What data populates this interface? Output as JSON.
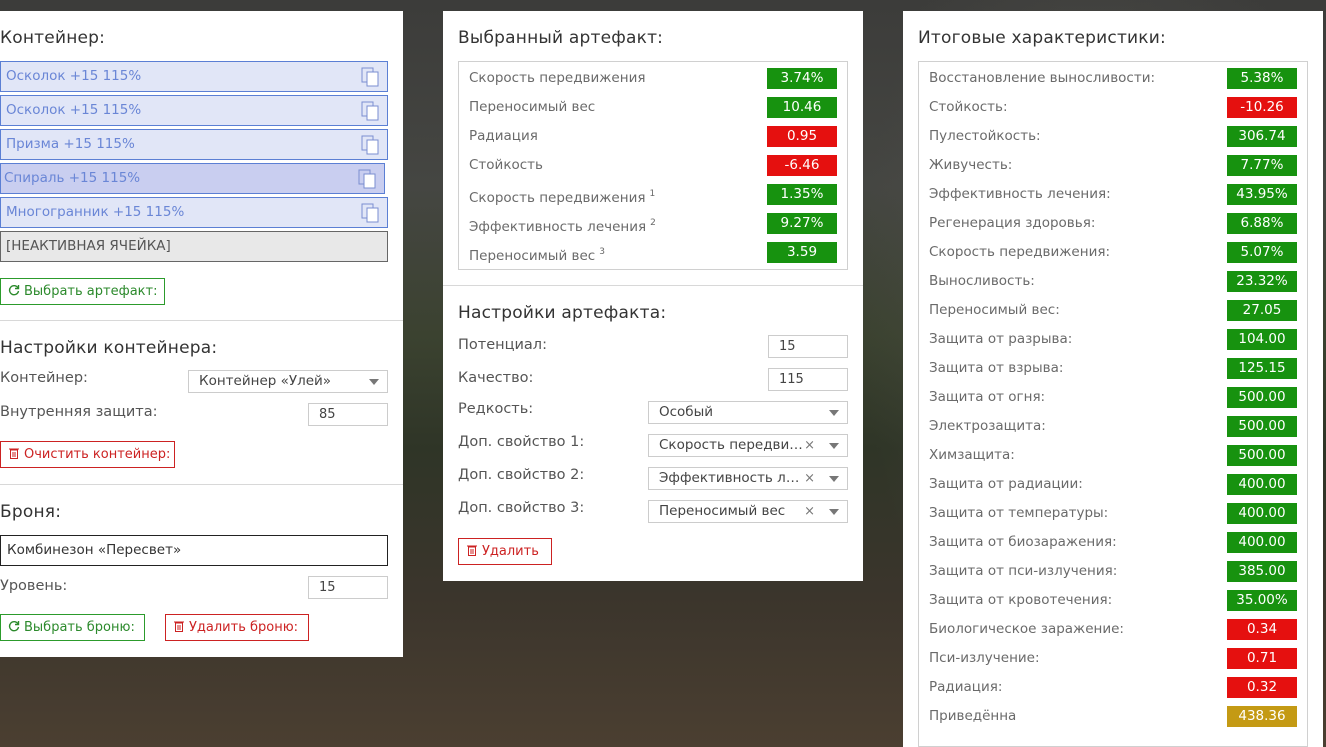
{
  "container": {
    "title": "Контейнер:",
    "slots": [
      {
        "label": "Осколок +15 115%"
      },
      {
        "label": "Осколок +15 115%"
      },
      {
        "label": "Призма +15 115%"
      },
      {
        "label": "Спираль +15 115%"
      },
      {
        "label": "Многогранник +15 115%"
      },
      {
        "label": "[НЕАКТИВНАЯ ЯЧЕЙКА]"
      }
    ],
    "choose_artifact_label": "Выбрать артефакт:"
  },
  "container_settings": {
    "title": "Настройки контейнера:",
    "container_label": "Контейнер:",
    "container_value": "Контейнер «Улей»",
    "internal_protection_label": "Внутренняя защита:",
    "internal_protection_value": "85",
    "clear_label": "Очистить контейнер:"
  },
  "armor": {
    "title": "Броня:",
    "value": "Комбинезон «Пересвет»",
    "level_label": "Уровень:",
    "level_value": "15",
    "choose_label": "Выбрать броню:",
    "delete_label": "Удалить броню:"
  },
  "selected_artifact": {
    "title": "Выбранный артефакт:",
    "stats": [
      {
        "label": "Скорость передвижения",
        "sup": "",
        "value": "3.74%",
        "color": "green"
      },
      {
        "label": "Переносимый вес",
        "sup": "",
        "value": "10.46",
        "color": "green"
      },
      {
        "label": "Радиация",
        "sup": "",
        "value": "0.95",
        "color": "red"
      },
      {
        "label": "Стойкость",
        "sup": "",
        "value": "-6.46",
        "color": "red"
      },
      {
        "label": "Скорость передвижения",
        "sup": "1",
        "value": "1.35%",
        "color": "green"
      },
      {
        "label": "Эффективность лечения",
        "sup": "2",
        "value": "9.27%",
        "color": "green"
      },
      {
        "label": "Переносимый вес",
        "sup": "3",
        "value": "3.59",
        "color": "green"
      }
    ]
  },
  "artifact_settings": {
    "title": "Настройки артефакта:",
    "potential_label": "Потенциал:",
    "potential_value": "15",
    "quality_label": "Качество:",
    "quality_value": "115",
    "rarity_label": "Редкость:",
    "rarity_value": "Особый",
    "extra1_label": "Доп. свойство 1:",
    "extra1_value": "Скорость передвижения",
    "extra2_label": "Доп. свойство 2:",
    "extra2_value": "Эффективность лечения",
    "extra3_label": "Доп. свойство 3:",
    "extra3_value": "Переносимый вес",
    "clear_symbol": "×",
    "delete_label": "Удалить"
  },
  "totals": {
    "title": "Итоговые характеристики:",
    "stats": [
      {
        "label": "Восстановление выносливости:",
        "value": "5.38%",
        "color": "green"
      },
      {
        "label": "Стойкость:",
        "value": "-10.26",
        "color": "red"
      },
      {
        "label": "Пулестойкость:",
        "value": "306.74",
        "color": "green"
      },
      {
        "label": "Живучесть:",
        "value": "7.77%",
        "color": "green"
      },
      {
        "label": "Эффективность лечения:",
        "value": "43.95%",
        "color": "green"
      },
      {
        "label": "Регенерация здоровья:",
        "value": "6.88%",
        "color": "green"
      },
      {
        "label": "Скорость передвижения:",
        "value": "5.07%",
        "color": "green"
      },
      {
        "label": "Выносливость:",
        "value": "23.32%",
        "color": "green"
      },
      {
        "label": "Переносимый вес:",
        "value": "27.05",
        "color": "green"
      },
      {
        "label": "Защита от разрыва:",
        "value": "104.00",
        "color": "green"
      },
      {
        "label": "Защита от взрыва:",
        "value": "125.15",
        "color": "green"
      },
      {
        "label": "Защита от огня:",
        "value": "500.00",
        "color": "green"
      },
      {
        "label": "Электрозащита:",
        "value": "500.00",
        "color": "green"
      },
      {
        "label": "Химзащита:",
        "value": "500.00",
        "color": "green"
      },
      {
        "label": "Защита от радиации:",
        "value": "400.00",
        "color": "green"
      },
      {
        "label": "Защита от температуры:",
        "value": "400.00",
        "color": "green"
      },
      {
        "label": "Защита от биозаражения:",
        "value": "400.00",
        "color": "green"
      },
      {
        "label": "Защита от пси-излучения:",
        "value": "385.00",
        "color": "green"
      },
      {
        "label": "Защита от кровотечения:",
        "value": "35.00%",
        "color": "green"
      },
      {
        "label": "Биологическое заражение:",
        "value": "0.34",
        "color": "red"
      },
      {
        "label": "Пси-излучение:",
        "value": "0.71",
        "color": "red"
      },
      {
        "label": "Радиация:",
        "value": "0.32",
        "color": "red"
      },
      {
        "label": "Приведённа",
        "value": "438.36",
        "color": "yellow"
      }
    ]
  },
  "colors": {
    "green": "#17920f",
    "red": "#e5100f",
    "yellow": "#c49a14",
    "slot_border": "#5b7fd4"
  },
  "icons": {
    "slot": "copy-icon",
    "choose": "refresh-icon",
    "delete": "trash-icon"
  }
}
